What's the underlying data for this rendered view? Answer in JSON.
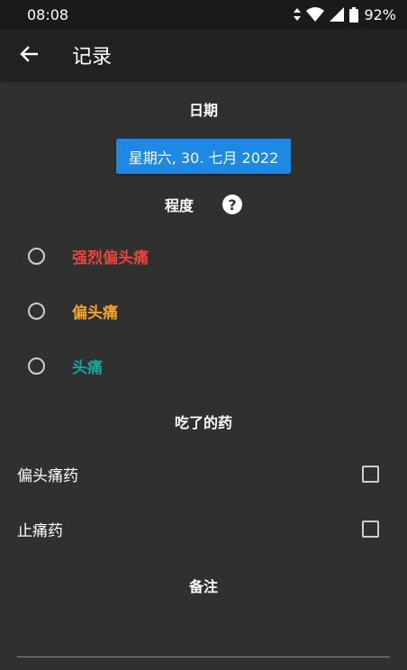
{
  "status_bar": {
    "time": "08:08",
    "battery": "92%"
  },
  "app_bar": {
    "title": "记录",
    "back_icon": "arrow-back-icon"
  },
  "date_section": {
    "heading": "日期",
    "date_button": "星期六, 30. 七月 2022"
  },
  "severity_section": {
    "heading": "程度",
    "help_icon": "help-circle-icon",
    "options": [
      {
        "label": "强烈偏头痛",
        "color": "#e8453c",
        "selected": false
      },
      {
        "label": "偏头痛",
        "color": "#f5a623",
        "selected": false
      },
      {
        "label": "头痛",
        "color": "#1aa59a",
        "selected": false
      }
    ]
  },
  "medication_section": {
    "heading": "吃了的药",
    "items": [
      {
        "label": "偏头痛药",
        "checked": false
      },
      {
        "label": "止痛药",
        "checked": false
      }
    ]
  },
  "notes_section": {
    "heading": "备注",
    "value": ""
  },
  "colors": {
    "background": "#303030",
    "app_bar": "#212121",
    "accent": "#1e88e5"
  }
}
